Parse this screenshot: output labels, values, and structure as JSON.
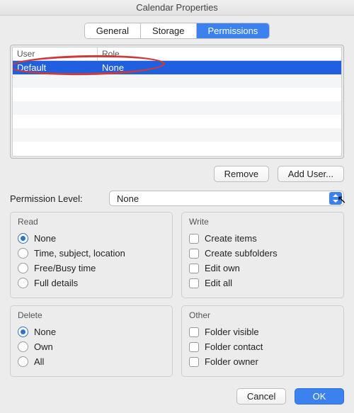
{
  "window": {
    "title": "Calendar Properties"
  },
  "tabs": {
    "general": "General",
    "storage": "Storage",
    "permissions": "Permissions",
    "active": "permissions"
  },
  "table": {
    "headers": {
      "user": "User",
      "role": "Role"
    },
    "rows": [
      {
        "user": "Default",
        "role": "None",
        "selected": true
      }
    ]
  },
  "buttons": {
    "remove": "Remove",
    "add_user": "Add User...",
    "cancel": "Cancel",
    "ok": "OK"
  },
  "permission_level": {
    "label": "Permission Level:",
    "value": "None"
  },
  "groups": {
    "read": {
      "title": "Read",
      "options": {
        "none": "None",
        "tsl": "Time, subject, location",
        "fbt": "Free/Busy time",
        "full": "Full details"
      },
      "selected": "none"
    },
    "write": {
      "title": "Write",
      "options": {
        "create_items": "Create items",
        "create_sub": "Create subfolders",
        "edit_own": "Edit own",
        "edit_all": "Edit all"
      }
    },
    "delete": {
      "title": "Delete",
      "options": {
        "none": "None",
        "own": "Own",
        "all": "All"
      },
      "selected": "none"
    },
    "other": {
      "title": "Other",
      "options": {
        "visible": "Folder visible",
        "contact": "Folder contact",
        "owner": "Folder owner"
      }
    }
  }
}
